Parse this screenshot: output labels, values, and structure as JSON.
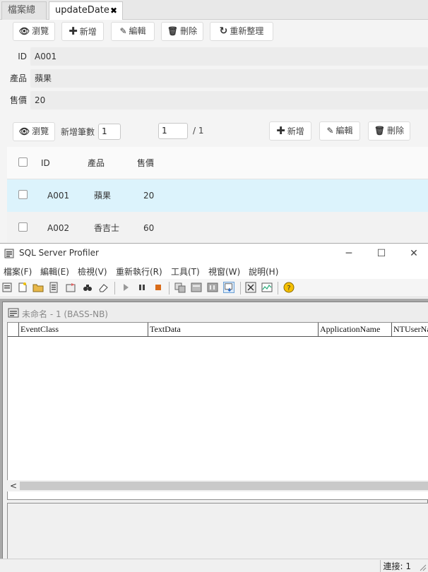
{
  "tabs": [
    {
      "label": "檔案總管"
    },
    {
      "label": "updateDate",
      "close": "✖"
    }
  ],
  "form_toolbar": {
    "browse": "瀏覽",
    "add": "新增",
    "edit": "編輯",
    "delete": "刪除",
    "refresh": "重新整理"
  },
  "fields": [
    {
      "label": "ID",
      "value": "A001"
    },
    {
      "label": "產品",
      "value": "蘋果"
    },
    {
      "label": "售價",
      "value": "20"
    }
  ],
  "grid_toolbar": {
    "browse": "瀏覽",
    "new_count_label": "新增筆數",
    "new_count_value": "1",
    "page_value": "1",
    "page_total": "/ 1",
    "add": "新增",
    "edit": "編輯",
    "delete": "刪除"
  },
  "grid": {
    "headers": [
      "ID",
      "產品",
      "售價"
    ],
    "rows": [
      {
        "id": "A001",
        "product": "蘋果",
        "price": "20"
      },
      {
        "id": "A002",
        "product": "香吉士",
        "price": "60"
      }
    ]
  },
  "profiler": {
    "title": "SQL Server Profiler",
    "menu": [
      "檔案(F)",
      "編輯(E)",
      "檢視(V)",
      "重新執行(R)",
      "工具(T)",
      "視窗(W)",
      "說明(H)"
    ],
    "child_title": "未命名 - 1 (BASS-NB)",
    "columns": [
      "EventClass",
      "TextData",
      "ApplicationName",
      "NTUserName"
    ],
    "status": "連接: 1"
  },
  "colors": {
    "selected_row": "#dcf3fc",
    "field_bg": "#ececec",
    "mdi_bg": "#a9a9a9"
  }
}
